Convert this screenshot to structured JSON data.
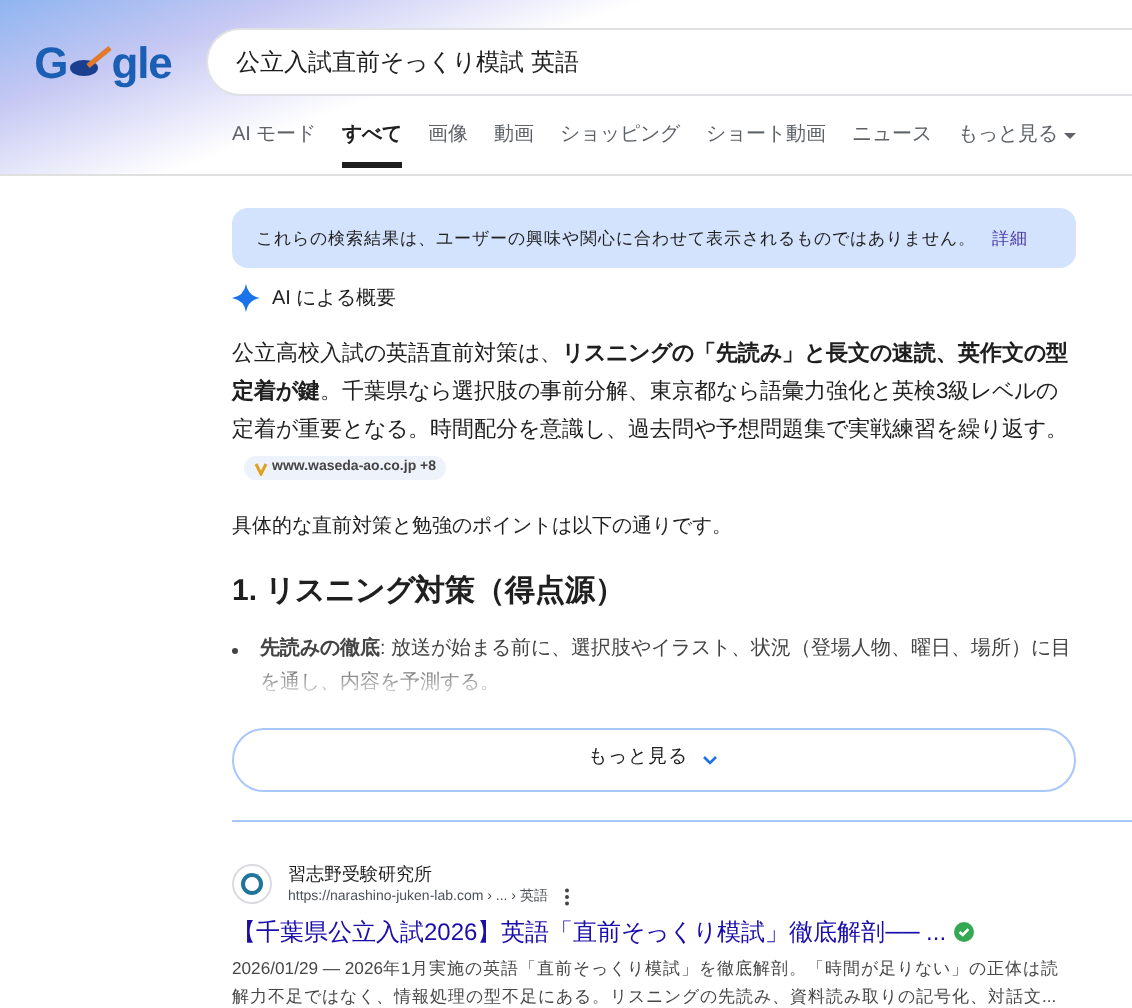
{
  "logo": {
    "left": "G",
    "right": "gle"
  },
  "search": {
    "value": "公立入試直前そっくり模試 英語"
  },
  "tabs": [
    {
      "label": "AI モード",
      "selected": false
    },
    {
      "label": "すべて",
      "selected": true
    },
    {
      "label": "画像",
      "selected": false
    },
    {
      "label": "動画",
      "selected": false
    },
    {
      "label": "ショッピング",
      "selected": false
    },
    {
      "label": "ショート動画",
      "selected": false
    },
    {
      "label": "ニュース",
      "selected": false
    },
    {
      "label": "もっと見る",
      "selected": false,
      "kind": "menu"
    }
  ],
  "notice": {
    "text": "これらの検索結果は、ユーザーの興味や関心に合わせて表示されるものではありません。",
    "link": "詳細"
  },
  "ai_overview": {
    "title": "AI による概要",
    "summary": "公立高校入試の英語直前対策は、**リスニングの「先読み」と長文の速読、英作文の型定着が鍵**。千葉県なら選択肢の事前分解、東京都なら語彙力強化と英検3級レベルの定着が重要となる。時間配分を意識し、過去問や予想問題集で実戦練習を繰り返す。",
    "source": "www.waseda-ao.co.jp +8",
    "intro": "具体的な直前対策と勉強のポイントは以下の通りです。",
    "heading": "1. リスニング対策（得点源）",
    "bullets": [
      "**先読みの徹底**: 放送が始まる前に、選択肢やイラスト、状況（登場人物、曜日、場所）に目を通し、内容を予測する。"
    ],
    "more_button": "もっと見る"
  },
  "results": [
    {
      "site": "習志野受験研究所",
      "url": "https://narashino-juken-lab.com › ... › 英語",
      "title": "【千葉県公立入試2026】英語「直前そっくり模試」徹底解剖── ...",
      "verified": true,
      "snippet": "2026/01/29 — 2026年1月実施の英語「直前そっくり模試」を徹底解剖。「時間が足りない」の正体は読解力不足ではなく、情報処理の型不足にある。リスニングの先読み、資料読み取りの記号化、対話文..."
    }
  ]
}
